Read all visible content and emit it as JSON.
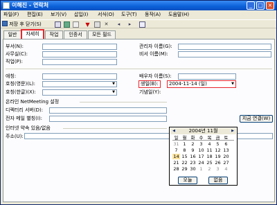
{
  "window": {
    "title": "이해진 - 연락처",
    "controls": [
      "_",
      "□",
      "×"
    ]
  },
  "menu": [
    "파일(F)",
    "편집(E)",
    "보기(V)",
    "삽입(I)",
    "서식(O)",
    "도구(T)",
    "동작(A)",
    "도움말(H)"
  ],
  "toolbar": {
    "save_close_label": "저장 후 닫기(S)"
  },
  "tabs": [
    "일반",
    "자세히",
    "작업",
    "인증서",
    "모든 필드"
  ],
  "active_tab": "자세히",
  "form": {
    "department_label": "부서(N):",
    "office_label": "사무실(C):",
    "profession_label": "직업(P):",
    "manager_label": "관리자 이름(G):",
    "assistant_label": "비서 이름(M):",
    "nickname_label": "애칭:",
    "title_en_label": "호칭(영문)(L):",
    "title_ko_label": "호칭(한글)(X):",
    "spouse_label": "배우자 이름(S):",
    "birthday_label": "생일(B):",
    "birthday_value": "2004-11-14 (일)",
    "anniversary_label": "기념일(Y):",
    "netmeeting_section": "온라인 NetMeeting 설정",
    "directory_label": "디렉터리 서버(D):",
    "email_alias_label": "전자 메일 별칭(I):",
    "connect_button": "지금 연결(W)",
    "freebusy_section": "인터넷 약속 있음/없음",
    "address_label": "주소(U):"
  },
  "calendar": {
    "month_title": "2004년 11월",
    "weekdays": [
      "일",
      "월",
      "화",
      "수",
      "목",
      "금",
      "토"
    ],
    "weeks": [
      [
        "31",
        "1",
        "2",
        "3",
        "4",
        "5",
        "6"
      ],
      [
        "7",
        "8",
        "9",
        "10",
        "11",
        "12",
        "13"
      ],
      [
        "14",
        "15",
        "16",
        "17",
        "18",
        "19",
        "20"
      ],
      [
        "21",
        "22",
        "23",
        "24",
        "25",
        "26",
        "27"
      ],
      [
        "28",
        "29",
        "30",
        "1",
        "2",
        "3",
        "4"
      ]
    ],
    "selected_day": "14",
    "today_button": "오늘",
    "none_button": "없음"
  }
}
